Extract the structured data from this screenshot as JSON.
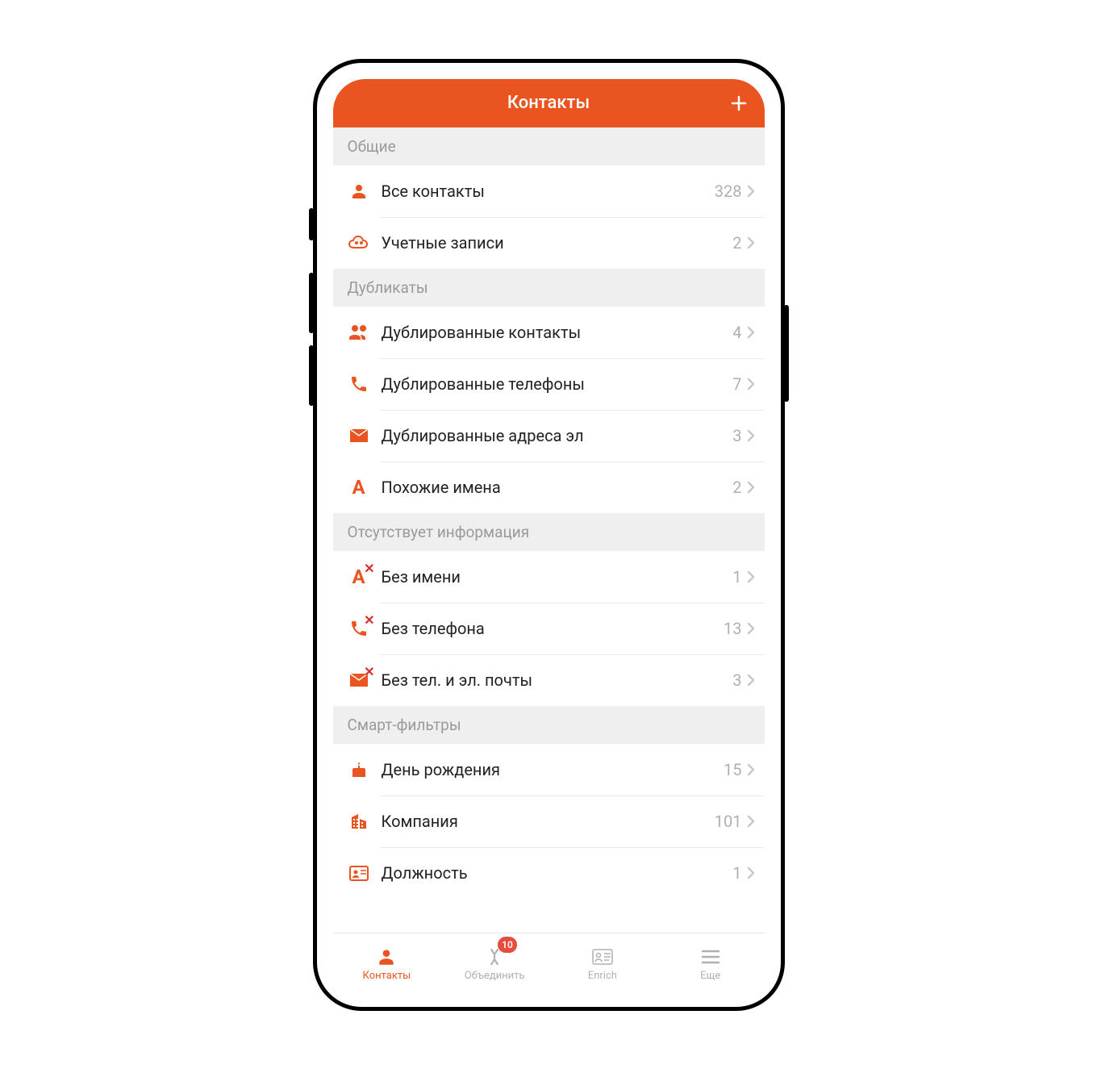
{
  "header": {
    "title": "Контакты"
  },
  "sections": [
    {
      "title": "Общие",
      "rows": [
        {
          "icon": "person",
          "label": "Все контакты",
          "count": 328
        },
        {
          "icon": "cloud-group",
          "label": "Учетные записи",
          "count": 2
        }
      ]
    },
    {
      "title": "Дубликаты",
      "rows": [
        {
          "icon": "people",
          "label": "Дублированные контакты",
          "count": 4
        },
        {
          "icon": "phone",
          "label": "Дублированные телефоны",
          "count": 7
        },
        {
          "icon": "mail",
          "label": "Дублированные адреса эл",
          "count": 3
        },
        {
          "icon": "letter-a",
          "label": "Похожие имена",
          "count": 2
        }
      ]
    },
    {
      "title": "Отсутствует информация",
      "rows": [
        {
          "icon": "letter-a-x",
          "label": "Без имени",
          "count": 1
        },
        {
          "icon": "phone-x",
          "label": "Без телефона",
          "count": 13
        },
        {
          "icon": "mail-x",
          "label": "Без тел. и эл. почты",
          "count": 3
        }
      ]
    },
    {
      "title": "Смарт-фильтры",
      "rows": [
        {
          "icon": "cake",
          "label": "День рождения",
          "count": 15
        },
        {
          "icon": "building",
          "label": "Компания",
          "count": 101
        },
        {
          "icon": "id-card",
          "label": "Должность",
          "count": 1
        }
      ]
    }
  ],
  "tabbar": {
    "items": [
      {
        "icon": "person",
        "label": "Контакты",
        "active": true
      },
      {
        "icon": "merge",
        "label": "Объединить",
        "badge": 10
      },
      {
        "icon": "enrich",
        "label": "Enrich"
      },
      {
        "icon": "hamburger",
        "label": "Еще"
      }
    ]
  }
}
